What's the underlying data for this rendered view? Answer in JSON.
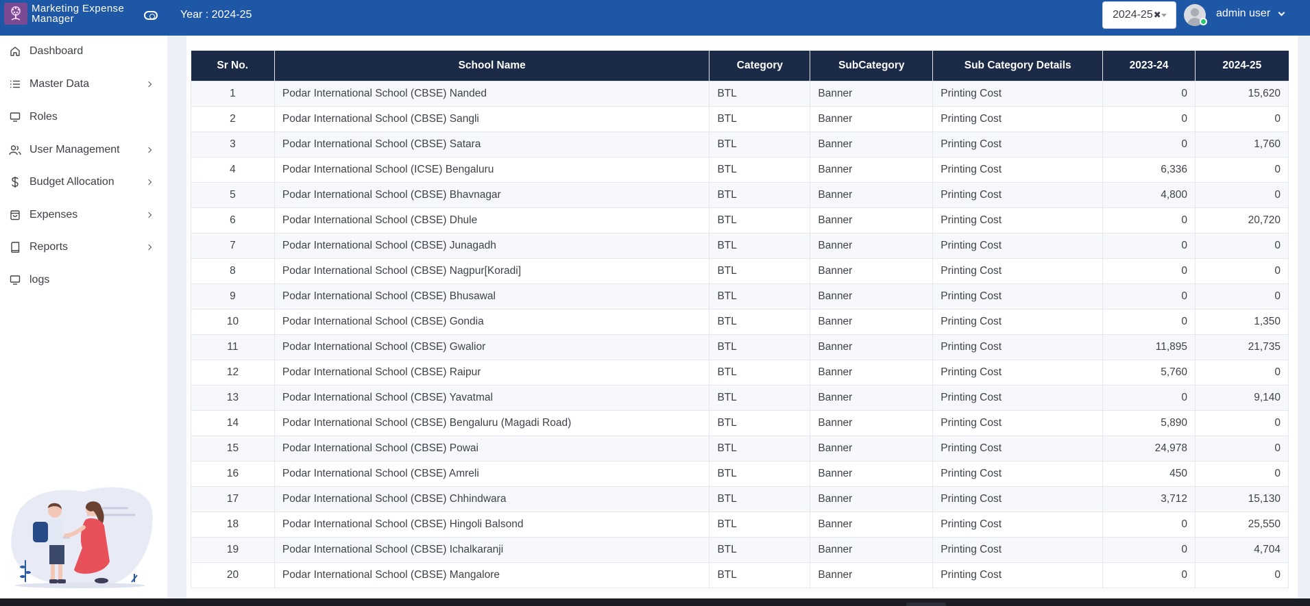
{
  "header": {
    "brand_line1": "Marketing Expense",
    "brand_line2": "Manager",
    "year_label": "Year : 2024-25",
    "year_select_value": "2024-25",
    "user_name": "admin user",
    "accent_color": "#1d57a6"
  },
  "sidebar": {
    "items": [
      {
        "label": "Dashboard",
        "icon": "home-icon"
      },
      {
        "label": "Master Data",
        "icon": "list-icon"
      },
      {
        "label": "Roles",
        "icon": "monitor-icon"
      },
      {
        "label": "User Management",
        "icon": "users-icon"
      },
      {
        "label": "Budget Allocation",
        "icon": "dollar-icon"
      },
      {
        "label": "Expenses",
        "icon": "bag-icon"
      },
      {
        "label": "Reports",
        "icon": "book-icon"
      },
      {
        "label": "logs",
        "icon": "monitor-icon"
      }
    ]
  },
  "table": {
    "headers": [
      "Sr No.",
      "School Name",
      "Category",
      "SubCategory",
      "Sub Category Details",
      "2023-24",
      "2024-25"
    ],
    "rows": [
      [
        "1",
        "Podar International School (CBSE) Nanded",
        "BTL",
        "Banner",
        "Printing Cost",
        "0",
        "15,620"
      ],
      [
        "2",
        "Podar International School (CBSE) Sangli",
        "BTL",
        "Banner",
        "Printing Cost",
        "0",
        "0"
      ],
      [
        "3",
        "Podar International School (CBSE) Satara",
        "BTL",
        "Banner",
        "Printing Cost",
        "0",
        "1,760"
      ],
      [
        "4",
        "Podar International School (ICSE) Bengaluru",
        "BTL",
        "Banner",
        "Printing Cost",
        "6,336",
        "0"
      ],
      [
        "5",
        "Podar International School (CBSE) Bhavnagar",
        "BTL",
        "Banner",
        "Printing Cost",
        "4,800",
        "0"
      ],
      [
        "6",
        "Podar International School (CBSE) Dhule",
        "BTL",
        "Banner",
        "Printing Cost",
        "0",
        "20,720"
      ],
      [
        "7",
        "Podar International School (CBSE) Junagadh",
        "BTL",
        "Banner",
        "Printing Cost",
        "0",
        "0"
      ],
      [
        "8",
        "Podar International School (CBSE) Nagpur[Koradi]",
        "BTL",
        "Banner",
        "Printing Cost",
        "0",
        "0"
      ],
      [
        "9",
        "Podar International School (CBSE) Bhusawal",
        "BTL",
        "Banner",
        "Printing Cost",
        "0",
        "0"
      ],
      [
        "10",
        "Podar International School (CBSE) Gondia",
        "BTL",
        "Banner",
        "Printing Cost",
        "0",
        "1,350"
      ],
      [
        "11",
        "Podar International School (CBSE) Gwalior",
        "BTL",
        "Banner",
        "Printing Cost",
        "11,895",
        "21,735"
      ],
      [
        "12",
        "Podar International School (CBSE) Raipur",
        "BTL",
        "Banner",
        "Printing Cost",
        "5,760",
        "0"
      ],
      [
        "13",
        "Podar International School (CBSE) Yavatmal",
        "BTL",
        "Banner",
        "Printing Cost",
        "0",
        "9,140"
      ],
      [
        "14",
        "Podar International School (CBSE) Bengaluru (Magadi Road)",
        "BTL",
        "Banner",
        "Printing Cost",
        "5,890",
        "0"
      ],
      [
        "15",
        "Podar International School (CBSE) Powai",
        "BTL",
        "Banner",
        "Printing Cost",
        "24,978",
        "0"
      ],
      [
        "16",
        "Podar International School (CBSE) Amreli",
        "BTL",
        "Banner",
        "Printing Cost",
        "450",
        "0"
      ],
      [
        "17",
        "Podar International School (CBSE) Chhindwara",
        "BTL",
        "Banner",
        "Printing Cost",
        "3,712",
        "15,130"
      ],
      [
        "18",
        "Podar International School (CBSE) Hingoli Balsond",
        "BTL",
        "Banner",
        "Printing Cost",
        "0",
        "25,550"
      ],
      [
        "19",
        "Podar International School (CBSE) Ichalkaranji",
        "BTL",
        "Banner",
        "Printing Cost",
        "0",
        "4,704"
      ],
      [
        "20",
        "Podar International School (CBSE) Mangalore",
        "BTL",
        "Banner",
        "Printing Cost",
        "0",
        "0"
      ]
    ]
  }
}
